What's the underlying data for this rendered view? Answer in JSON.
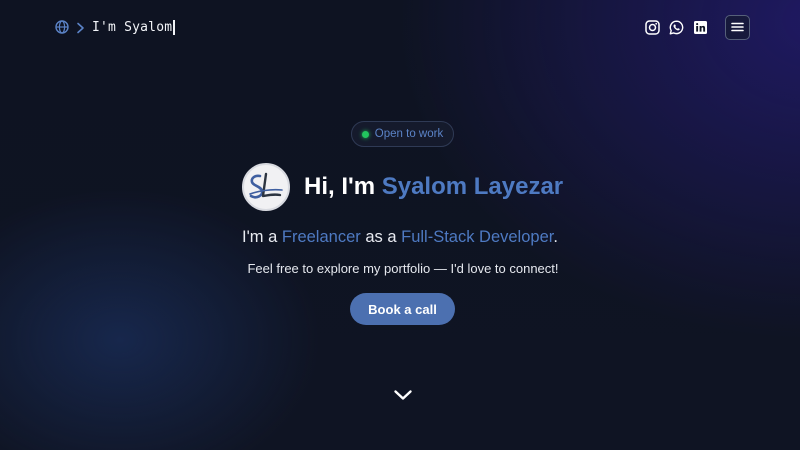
{
  "header": {
    "brand_text": "I'm Syalom",
    "socials": [
      {
        "name": "instagram-icon"
      },
      {
        "name": "whatsapp-icon"
      },
      {
        "name": "linkedin-icon"
      }
    ],
    "menu_icon": "hamburger-icon"
  },
  "hero": {
    "status": "Open to work",
    "status_color": "#22c55e",
    "title_prefix": "Hi, I'm ",
    "title_name": "Syalom Layezar",
    "subtitle": {
      "part1": "I'm a ",
      "role": "Freelancer",
      "part2": " as a ",
      "title": "Full-Stack Developer",
      "part3": "."
    },
    "tagline": "Feel free to explore my portfolio — I'd love to connect!",
    "cta_label": "Book a call"
  },
  "colors": {
    "accent": "#4e7ac2",
    "button": "#4c70b0",
    "background": "#0e1322"
  }
}
